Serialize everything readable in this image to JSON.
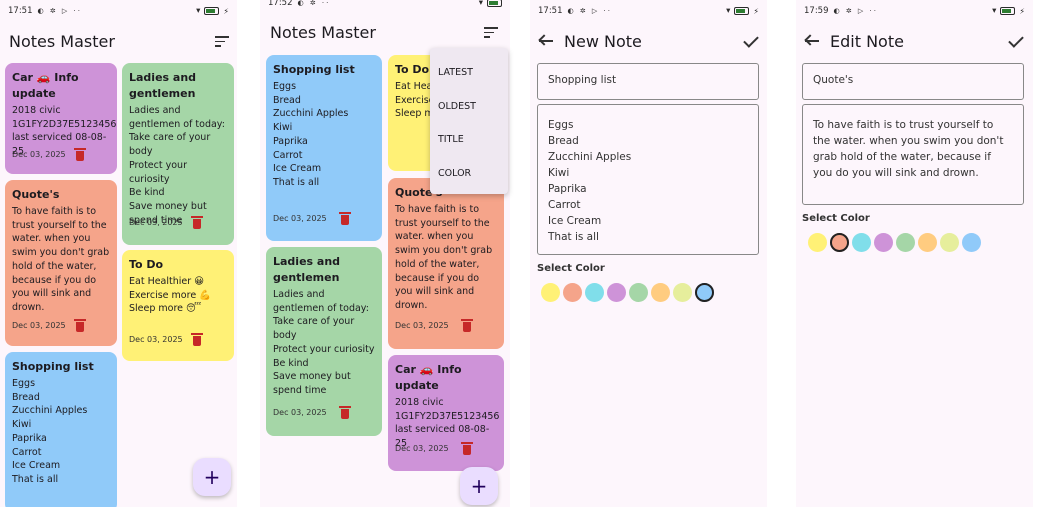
{
  "colors": {
    "yellow": "#fff176",
    "orange": "#f5a48a",
    "cyan": "#80deea",
    "purple": "#ce93d8",
    "green": "#a5d6a7",
    "amber": "#ffcc80",
    "lime": "#e6ee9c",
    "blue": "#90caf9"
  },
  "s1": {
    "status": {
      "time": "17:51",
      "indicators": "◐ ✲ ▷ ··"
    },
    "title": "Notes Master",
    "notes": [
      {
        "title": "Car 🚗 Info update",
        "body": "2018 civic\n1G1FY2D37E5123456\nlast serviced 08-08-25",
        "date": "Dec 03, 2025",
        "color": "purple"
      },
      {
        "title": "Quote's",
        "body": "To have faith is to trust yourself to the water. when you swim you don't grab hold of the water, because if you do you will sink and drown.",
        "date": "Dec 03, 2025",
        "color": "orange"
      },
      {
        "title": "Shopping list",
        "body": "Eggs\nBread\nZucchini Apples\nKiwi\nPaprika\nCarrot\nIce Cream\nThat is all",
        "date": "",
        "color": "blue"
      },
      {
        "title": "Ladies and gentlemen",
        "body": "Ladies and gentlemen of today:\nTake care of your body\nProtect your curiosity\nBe kind\nSave money but spend time",
        "date": "Dec 03, 2025",
        "color": "green"
      },
      {
        "title": "To Do",
        "body": "Eat Healthier 😀\nExercise more 💪\nSleep more 😴",
        "date": "Dec 03, 2025",
        "color": "yellow"
      }
    ],
    "fab": "+"
  },
  "s2": {
    "status": {
      "time": "17:52",
      "indicators": "◐ ✲ ··"
    },
    "title": "Notes Master",
    "notes": [
      {
        "title": "Shopping list",
        "body": "Eggs\nBread\nZucchini Apples\nKiwi\nPaprika\nCarrot\nIce Cream\nThat is all",
        "date": "Dec 03, 2025"
      },
      {
        "title": "Ladies and gentlemen",
        "body": "Ladies and gentlemen of today:\nTake care of your body\nProtect your curiosity\nBe kind\nSave money but spend time",
        "date": "Dec 03, 2025"
      },
      {
        "title": "To Do",
        "body": "Eat Heal\nExercise\nSleep m"
      },
      {
        "title": "Quote's",
        "body": "To have faith is to trust yourself to the water. when you swim you don't grab hold of the water, because if you do you will sink and drown.",
        "date": "Dec 03, 2025"
      },
      {
        "title": "Car 🚗 Info update",
        "body": "2018 civic\n1G1FY2D37E5123456\nlast serviced 08-08-25",
        "date": "Dec 03, 2025"
      }
    ],
    "menu": [
      "LATEST",
      "OLDEST",
      "TITLE",
      "COLOR"
    ],
    "fab": "+"
  },
  "s3": {
    "status": {
      "time": "17:51",
      "indicators": "◐ ✲ ▷ ··"
    },
    "title": "New Note",
    "note_title": "Shopping list",
    "note_body": "Eggs\nBread\nZucchini Apples\nKiwi\nPaprika\nCarrot\nIce Cream\nThat is all",
    "select_color": "Select Color",
    "selected_color": "blue"
  },
  "s4": {
    "status": {
      "time": "17:59",
      "indicators": "◐ ✲ ▷ ··"
    },
    "title": "Edit Note",
    "note_title": "Quote's",
    "note_body": "To have faith is to trust yourself to the water. when you swim you don't grab hold of the water, because if you do you will sink and drown.",
    "select_color": "Select Color",
    "selected_color": "orange"
  }
}
